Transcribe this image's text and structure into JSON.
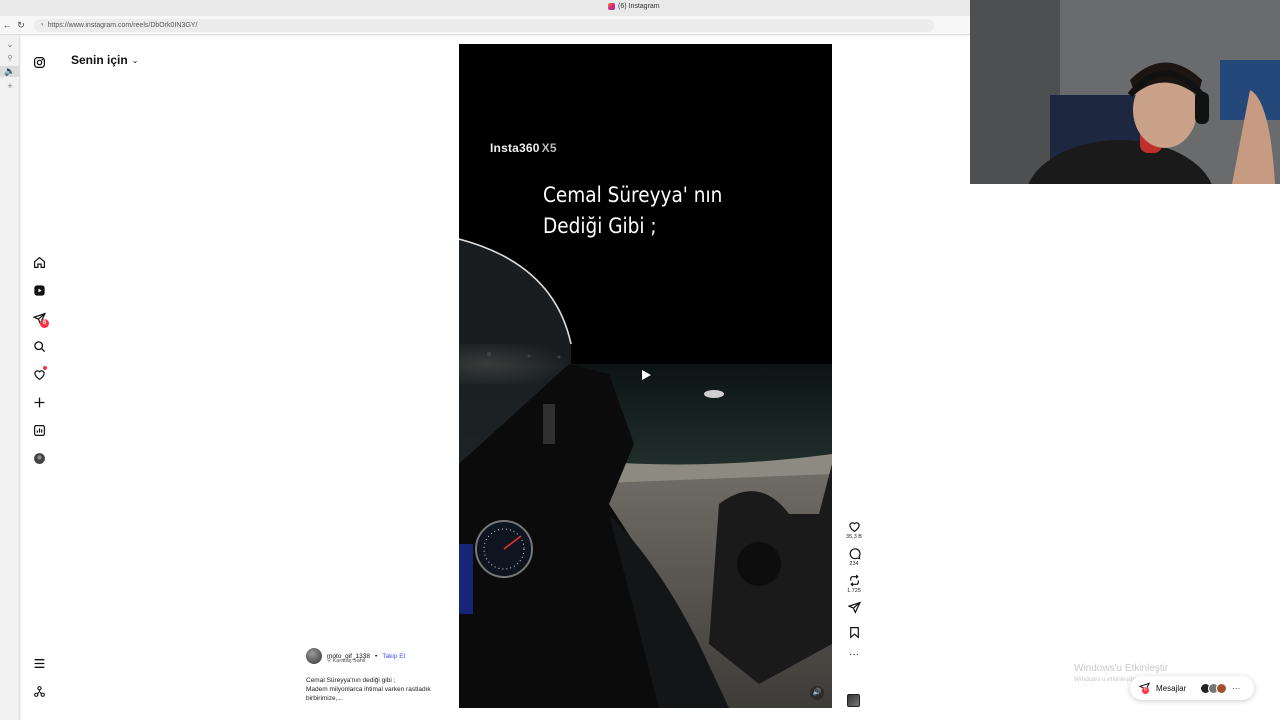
{
  "browser": {
    "tab_title": "(6) Instagram",
    "url": "https://www.instagram.com/reels/DbOrk0IN3GY/"
  },
  "nav": {
    "badge_count": "6",
    "icons": [
      "instagram-icon",
      "home-icon",
      "reels-icon",
      "messages-icon",
      "search-icon",
      "notifications-icon",
      "create-icon",
      "dashboard-icon",
      "profile-icon",
      "menu-icon",
      "meta-icon"
    ]
  },
  "feed": {
    "title": "Senin için"
  },
  "reel": {
    "watermark_main": "Insta360",
    "watermark_sub": "X5",
    "overlay_line1": "Cemal Süreyya' nın",
    "overlay_line2": "Dediği Gibi ;",
    "likes": "35,3 B",
    "comments": "234",
    "reposts": "1.725"
  },
  "author": {
    "username": "moto_gif_1338",
    "separator": "•",
    "follow": "Takip Et",
    "location": "Karataş Sahil",
    "caption_line1": "Cemal Süreyya'nın dediği gibi ;",
    "caption_line2": "Madem milyonlarca ihtimal varken rastladık",
    "caption_line3": "birbirimize,..."
  },
  "overlay": {
    "activate_title": "Windows'u Etkinleştir",
    "activate_sub": "Windows'u etkinleştirmek için Ayarlar'a gidin.",
    "messages_label": "Mesajlar"
  },
  "colors": {
    "accent": "#4150f7",
    "badge": "#ff3040"
  }
}
